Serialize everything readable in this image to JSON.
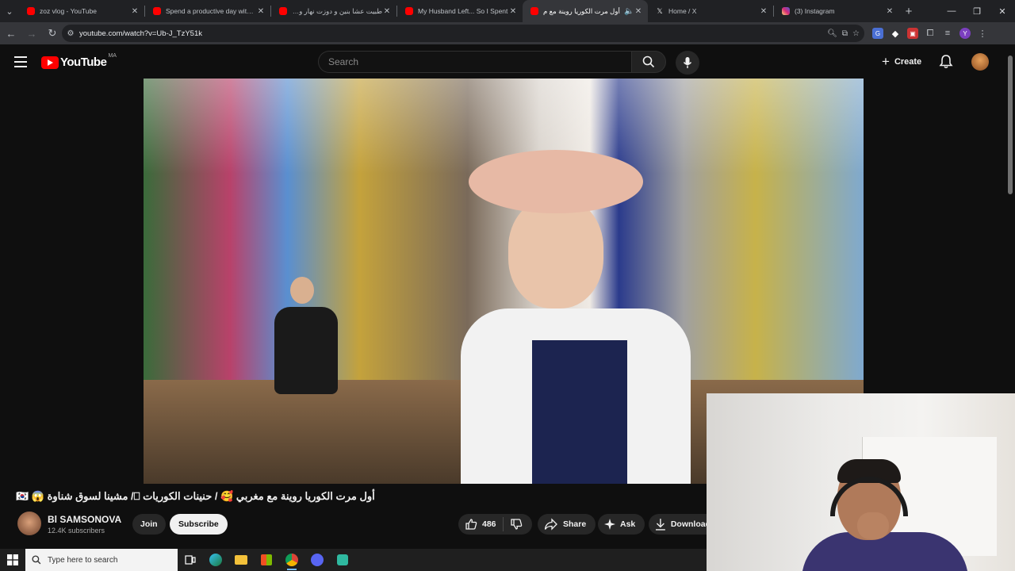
{
  "browser": {
    "tabs": [
      {
        "title": "zoz vlog - YouTube",
        "favicon_color": "#ff0000",
        "active": false
      },
      {
        "title": "Spend a productive day with m",
        "favicon_color": "#ff0000",
        "active": false
      },
      {
        "title": "طبيت عشا بنين و دوزت نهار واعر",
        "favicon_color": "#ff0000",
        "active": false
      },
      {
        "title": "My Husband Left... So I Spent",
        "favicon_color": "#ff0000",
        "active": false
      },
      {
        "title": "أول مرت الكوريا روينة مع م",
        "favicon_color": "#ff0000",
        "active": true
      },
      {
        "title": "Home / X",
        "favicon_color": "#e7e9ea",
        "active": false
      },
      {
        "title": "(3) Instagram",
        "favicon_color": "#d62976",
        "active": false
      }
    ],
    "url": "youtube.com/watch?v=Ub-J_TzY51k"
  },
  "youtube": {
    "logo_text": "YouTube",
    "country_code": "MA",
    "search_placeholder": "Search",
    "create_label": "Create"
  },
  "video": {
    "title": "أول مرت الكوريا روينة مع مغربي 🥰 / حنينات الكوريات ⎕/ مشينا لسوق شناوة 😱 🇰🇷",
    "channel_name": "Bl SAMSONOVA",
    "subscribers": "12.4K subscribers",
    "join_label": "Join",
    "subscribe_label": "Subscribe",
    "likes": "486",
    "share_label": "Share",
    "ask_label": "Ask",
    "download_label": "Download"
  },
  "taskbar": {
    "search_placeholder": "Type here to search",
    "icons": [
      "task-view-icon",
      "edge-icon",
      "file-explorer-icon",
      "store-icon",
      "chrome-icon",
      "discord-icon",
      "app-icon"
    ]
  }
}
